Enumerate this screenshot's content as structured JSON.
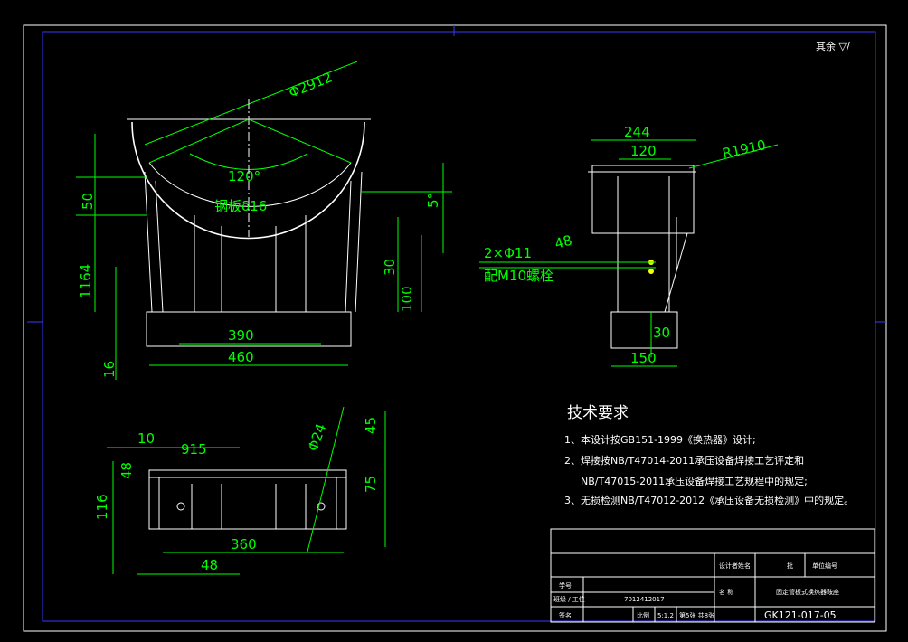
{
  "sheet": {
    "corner_mark": "其余 ▽/",
    "drawing_no": "GK121-017-05",
    "part_name": "固定管板式换热器鞍座",
    "student_no": "7012412017",
    "title_block": {
      "r1_c1": "设计者姓名",
      "r1_c2": "批",
      "r1_c3": "单位编号",
      "r2_label": "学号",
      "r3_label": "班级 / 工位",
      "r3_label2": "名 称",
      "r4_label": "签名",
      "r4_c2": "比例",
      "r4_c3": "5:1.2",
      "r4_c4": "第5张 共8张"
    }
  },
  "tech_req": {
    "heading": "技术要求",
    "items": [
      "1、本设计按GB151-1999《换热器》设计;",
      "2、焊接按NB/T47014-2011承压设备焊接工艺评定和",
      "NB/T47015-2011承压设备焊接工艺规程中的规定;",
      "3、无损检测NB/T47012-2012《承压设备无损检测》中的规定。"
    ]
  },
  "dimensions": {
    "front": {
      "dia": "Φ2912",
      "angle": "120°",
      "thickness_note": "钢板δ16",
      "h50": "50",
      "h1164": "1164",
      "h16": "16",
      "w390": "390",
      "w460": "460",
      "r30": "30",
      "r100": "100",
      "ang_small": "5°"
    },
    "side": {
      "w244": "244",
      "w120": "120",
      "r_label": "R1910",
      "holes": "2×Φ11",
      "bolt": "配M10螺栓",
      "d48": "48",
      "d30": "30",
      "w150": "150"
    },
    "plan": {
      "d10": "10",
      "d915": "915",
      "d48a": "48",
      "d116": "116",
      "dia24": "Φ24",
      "d45": "45",
      "d75": "75",
      "w360": "360",
      "w48b": "48"
    }
  }
}
